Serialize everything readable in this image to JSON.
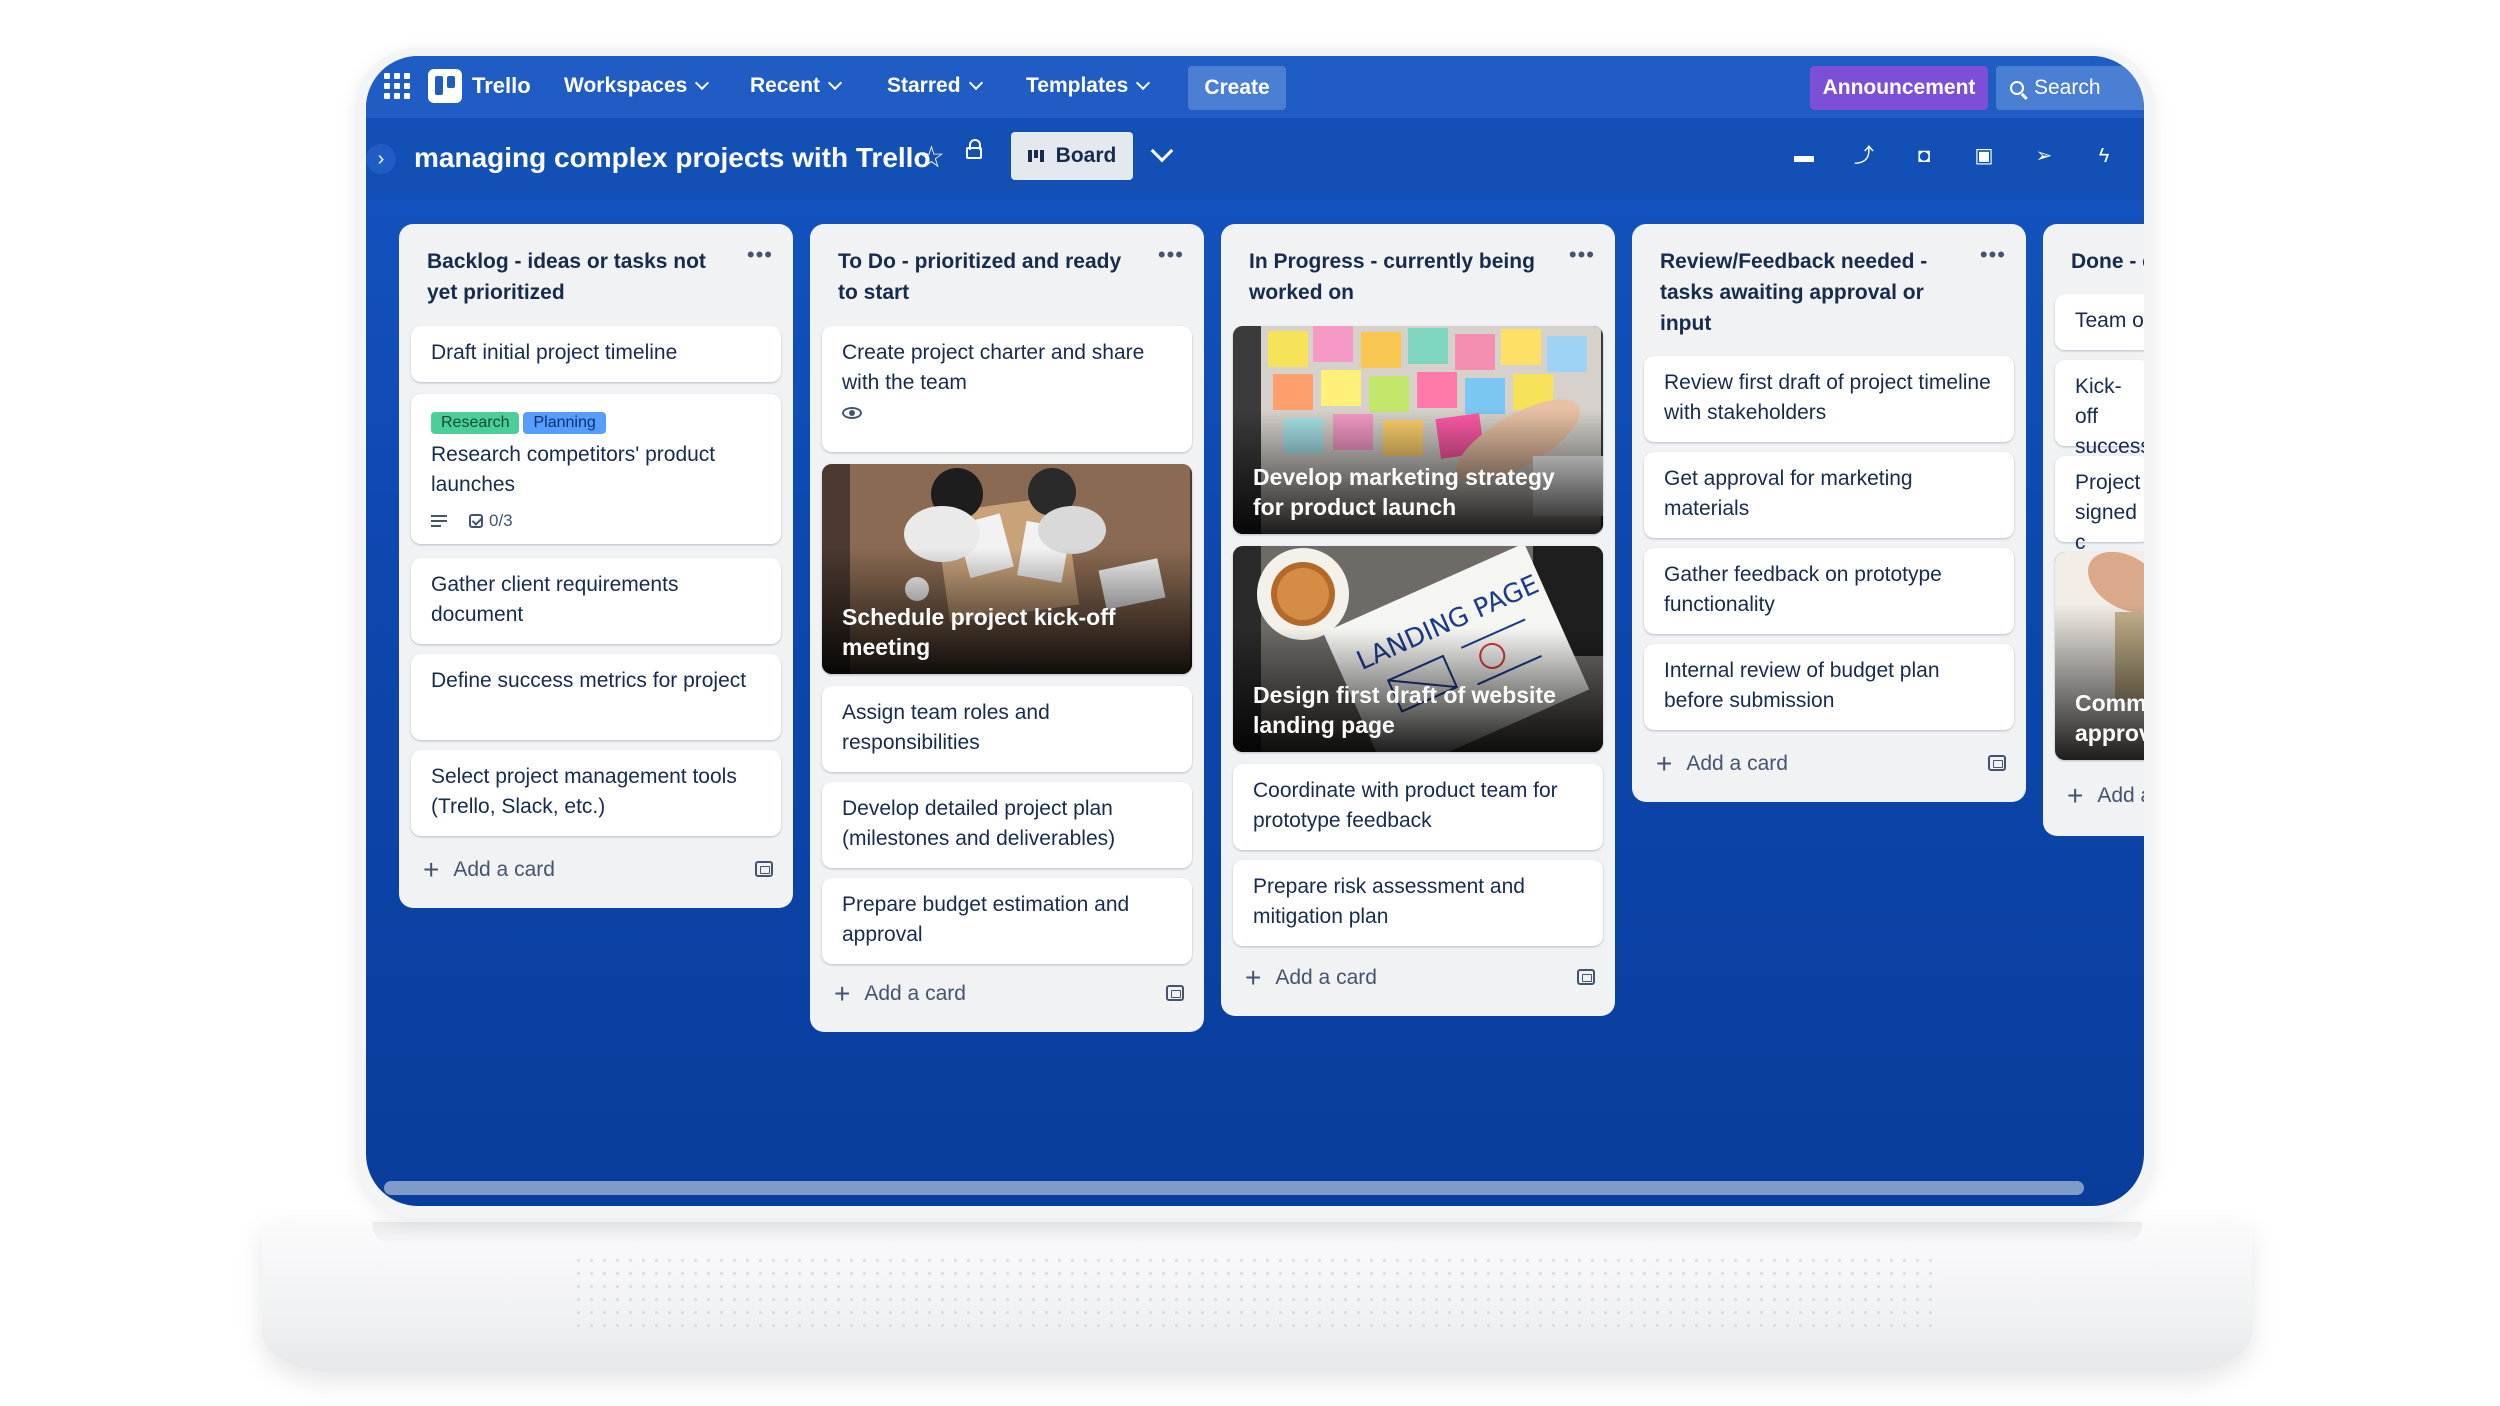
{
  "nav": {
    "logo": "Trello",
    "items": [
      {
        "label": "Workspaces"
      },
      {
        "label": "Recent"
      },
      {
        "label": "Starred"
      },
      {
        "label": "Templates"
      }
    ],
    "create": "Create",
    "announcement": "Announcement",
    "search": "Search"
  },
  "board": {
    "title": "managing complex projects with Trello",
    "view": "Board"
  },
  "colors": {
    "nav_bg": "#1f5cc4",
    "board_bg": "#0d47ae",
    "announce": "#7b4fd6",
    "label_research": "#4bce97",
    "label_planning": "#579dff"
  },
  "lists": [
    {
      "title": "Backlog - ideas or tasks not yet prioritized",
      "cards": [
        {
          "text": "Draft initial project timeline"
        },
        {
          "labels": [
            "Research",
            "Planning"
          ],
          "text": "Research competitors' product launches",
          "checklist": "0/3"
        },
        {
          "text": "Gather client requirements document"
        },
        {
          "text": "Define success metrics for project"
        },
        {
          "text": "Select project management tools (Trello, Slack, etc.)"
        }
      ],
      "add": "Add a card"
    },
    {
      "title": "To Do - prioritized and ready to start",
      "cards": [
        {
          "text": "Create project charter and share with the team"
        },
        {
          "text": "Schedule project kick-off meeting"
        },
        {
          "text": "Assign team roles and responsibilities"
        },
        {
          "text": "Develop detailed project plan (milestones and deliverables)"
        },
        {
          "text": "Prepare budget estimation and approval"
        }
      ],
      "add": "Add a card"
    },
    {
      "title": "In Progress - currently being worked on",
      "cards": [
        {
          "text": "Develop marketing strategy for product launch"
        },
        {
          "text": "Design first draft of website landing page",
          "image_text": "LANDING PAGE"
        },
        {
          "text": "Coordinate with product team for prototype feedback"
        },
        {
          "text": "Prepare risk assessment and mitigation plan"
        }
      ],
      "add": "Add a card"
    },
    {
      "title": "Review/Feedback needed - tasks awaiting approval or input",
      "cards": [
        {
          "text": "Review first draft of project timeline with stakeholders"
        },
        {
          "text": "Get approval for marketing materials"
        },
        {
          "text": "Gather feedback on prototype functionality"
        },
        {
          "text": "Internal review of budget plan before submission"
        }
      ],
      "add": "Add a card"
    },
    {
      "title": "Done - c",
      "cards": [
        {
          "text": "Team or"
        },
        {
          "text": "Kick-off success"
        },
        {
          "text": "Project signed c"
        },
        {
          "text": "Comm approv"
        }
      ],
      "add": "Add a"
    }
  ]
}
